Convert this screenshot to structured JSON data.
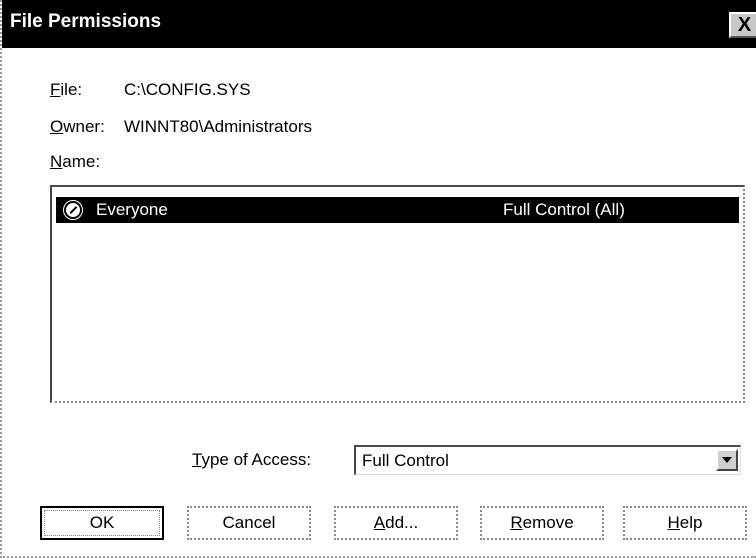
{
  "window": {
    "title": "File Permissions",
    "close_label": "X"
  },
  "info": {
    "file_label_accel": "F",
    "file_label_rest": "ile:",
    "file_value": "C:\\CONFIG.SYS",
    "owner_label_accel": "O",
    "owner_label_rest": "wner:",
    "owner_value": "WINNT80\\Administrators",
    "name_label_accel": "N",
    "name_label_rest": "ame:"
  },
  "permissions": {
    "rows": [
      {
        "icon": "globe-icon",
        "name": "Everyone",
        "access": "Full Control (All)",
        "selected": true
      }
    ]
  },
  "type_of_access": {
    "label_accel": "T",
    "label_rest": "ype of Access:",
    "value": "Full Control"
  },
  "buttons": {
    "ok": "OK",
    "cancel": "Cancel",
    "add_accel": "A",
    "add_rest": "dd...",
    "remove_accel": "R",
    "remove_rest": "emove",
    "help_accel": "H",
    "help_rest": "elp"
  },
  "colors": {
    "titlebar": "#000000",
    "selection": "#000000",
    "background": "#ffffff"
  }
}
